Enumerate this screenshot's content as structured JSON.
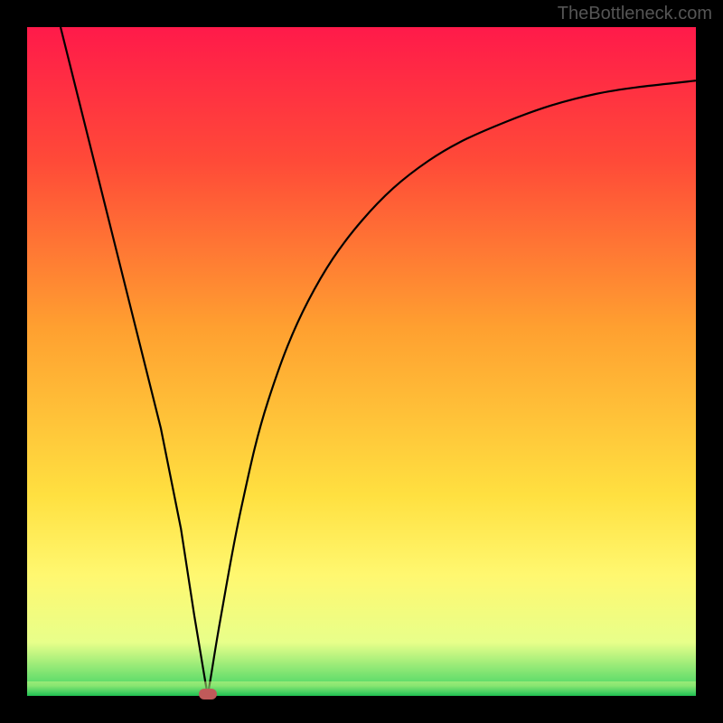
{
  "watermark": "TheBottleneck.com",
  "chart_data": {
    "type": "line",
    "title": "",
    "xlabel": "",
    "ylabel": "",
    "xlim": [
      0,
      100
    ],
    "ylim": [
      0,
      100
    ],
    "gradient_stops": [
      {
        "offset": 0,
        "color": "#ff1a4a"
      },
      {
        "offset": 20,
        "color": "#ff4a38"
      },
      {
        "offset": 45,
        "color": "#ffa030"
      },
      {
        "offset": 70,
        "color": "#ffe040"
      },
      {
        "offset": 82,
        "color": "#fff870"
      },
      {
        "offset": 92,
        "color": "#e8ff8a"
      },
      {
        "offset": 100,
        "color": "#30d060"
      }
    ],
    "series": [
      {
        "name": "bottleneck-curve",
        "description": "V-shaped curve with sharp minimum; left branch nearly linear descending, right branch rises with decreasing slope (asymptotic)",
        "minimum_x": 27,
        "minimum_y": 0,
        "points": [
          {
            "x": 5,
            "y": 100
          },
          {
            "x": 8,
            "y": 88
          },
          {
            "x": 12,
            "y": 72
          },
          {
            "x": 16,
            "y": 56
          },
          {
            "x": 20,
            "y": 40
          },
          {
            "x": 23,
            "y": 25
          },
          {
            "x": 25,
            "y": 12
          },
          {
            "x": 26.5,
            "y": 3
          },
          {
            "x": 27,
            "y": 0
          },
          {
            "x": 27.5,
            "y": 3
          },
          {
            "x": 29,
            "y": 12
          },
          {
            "x": 32,
            "y": 28
          },
          {
            "x": 36,
            "y": 44
          },
          {
            "x": 42,
            "y": 59
          },
          {
            "x": 50,
            "y": 71
          },
          {
            "x": 60,
            "y": 80
          },
          {
            "x": 72,
            "y": 86
          },
          {
            "x": 85,
            "y": 90
          },
          {
            "x": 100,
            "y": 92
          }
        ]
      }
    ]
  }
}
